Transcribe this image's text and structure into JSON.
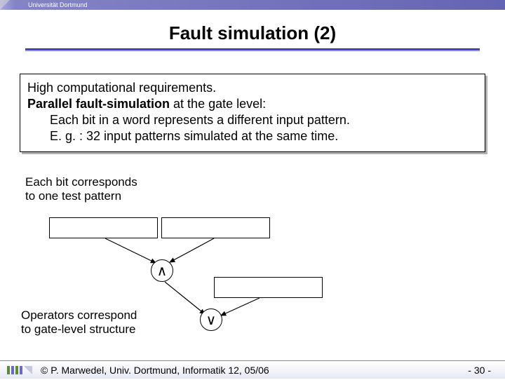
{
  "topbar": {
    "institution": "Universität Dortmund"
  },
  "title": "Fault simulation (2)",
  "box": {
    "line1": "High computational requirements.",
    "line2a": "Parallel fault-simulation",
    "line2b": " at the gate level:",
    "indent1": "Each bit in a word represents a different input pattern.",
    "indent2": "E. g. : 32 input patterns simulated at the same time."
  },
  "caption1": {
    "l1": "Each bit corresponds",
    "l2": "to one test pattern"
  },
  "gates": {
    "and": "∧",
    "or": "∨"
  },
  "caption2": {
    "l1": "Operators correspond",
    "l2": "to gate-level structure"
  },
  "footer": {
    "copyright": "© P. Marwedel, Univ. Dortmund, Informatik 12, 05/06",
    "page_prefix": "-  ",
    "page_num": "30",
    "page_suffix": " -"
  }
}
